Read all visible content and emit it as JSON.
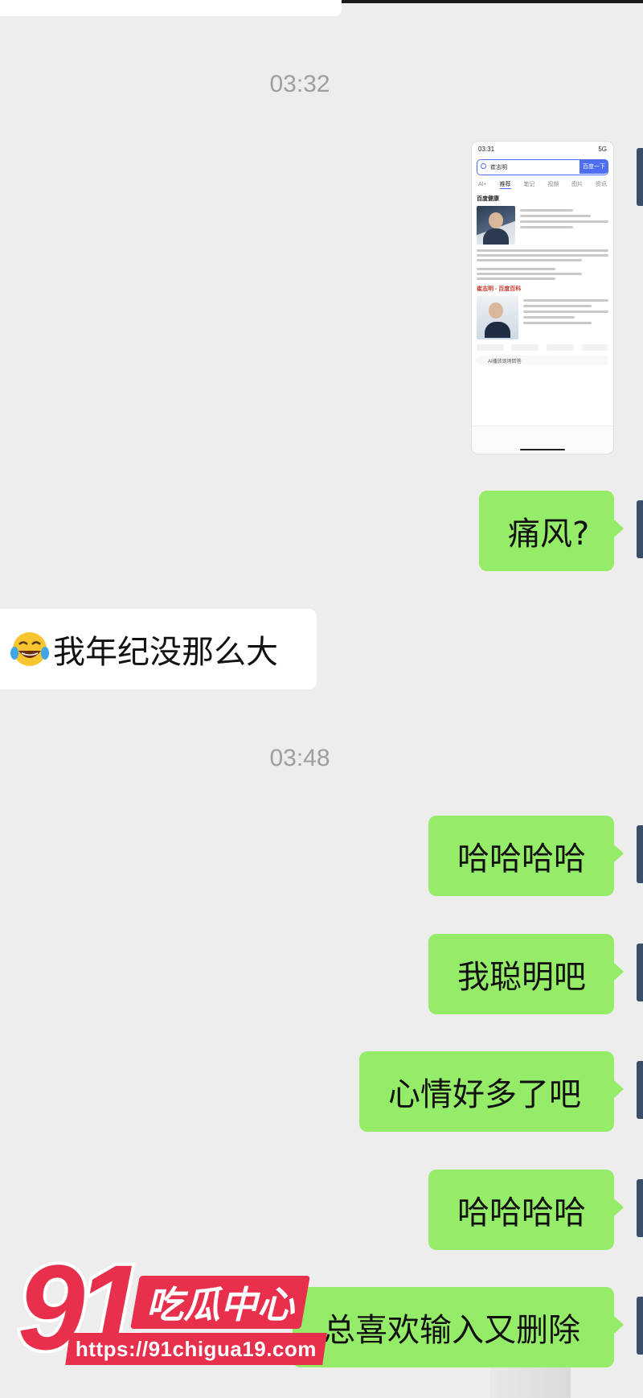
{
  "chat": {
    "timestamps": [
      "03:32",
      "03:48"
    ],
    "messages": {
      "m1": "痛风?",
      "m2": "我年纪没那么大",
      "m2_emoji": "tears-of-joy-emoji",
      "m3": "哈哈哈哈",
      "m4": "我聪明吧",
      "m5": "心情好多了吧",
      "m6": "哈哈哈哈",
      "m7": "总喜欢输入又删除"
    }
  },
  "screenshot": {
    "time": "03:31",
    "signal": "5G",
    "search_query": "崔志明",
    "search_button": "百度一下",
    "tabs": [
      "AI+",
      "推荐",
      "笔记",
      "视频",
      "图片",
      "资讯"
    ],
    "section1": "百度健康",
    "section2": "崔志明 - 百度百科",
    "address_text": "AI播放现场回答"
  },
  "watermark": {
    "number": "91",
    "brand": "吃瓜中心",
    "url": "https://91chigua19.com"
  },
  "colors": {
    "outgoing_bubble": "#95ec69",
    "incoming_bubble": "#ffffff",
    "background": "#ededed",
    "watermark_red": "#e8304d"
  }
}
